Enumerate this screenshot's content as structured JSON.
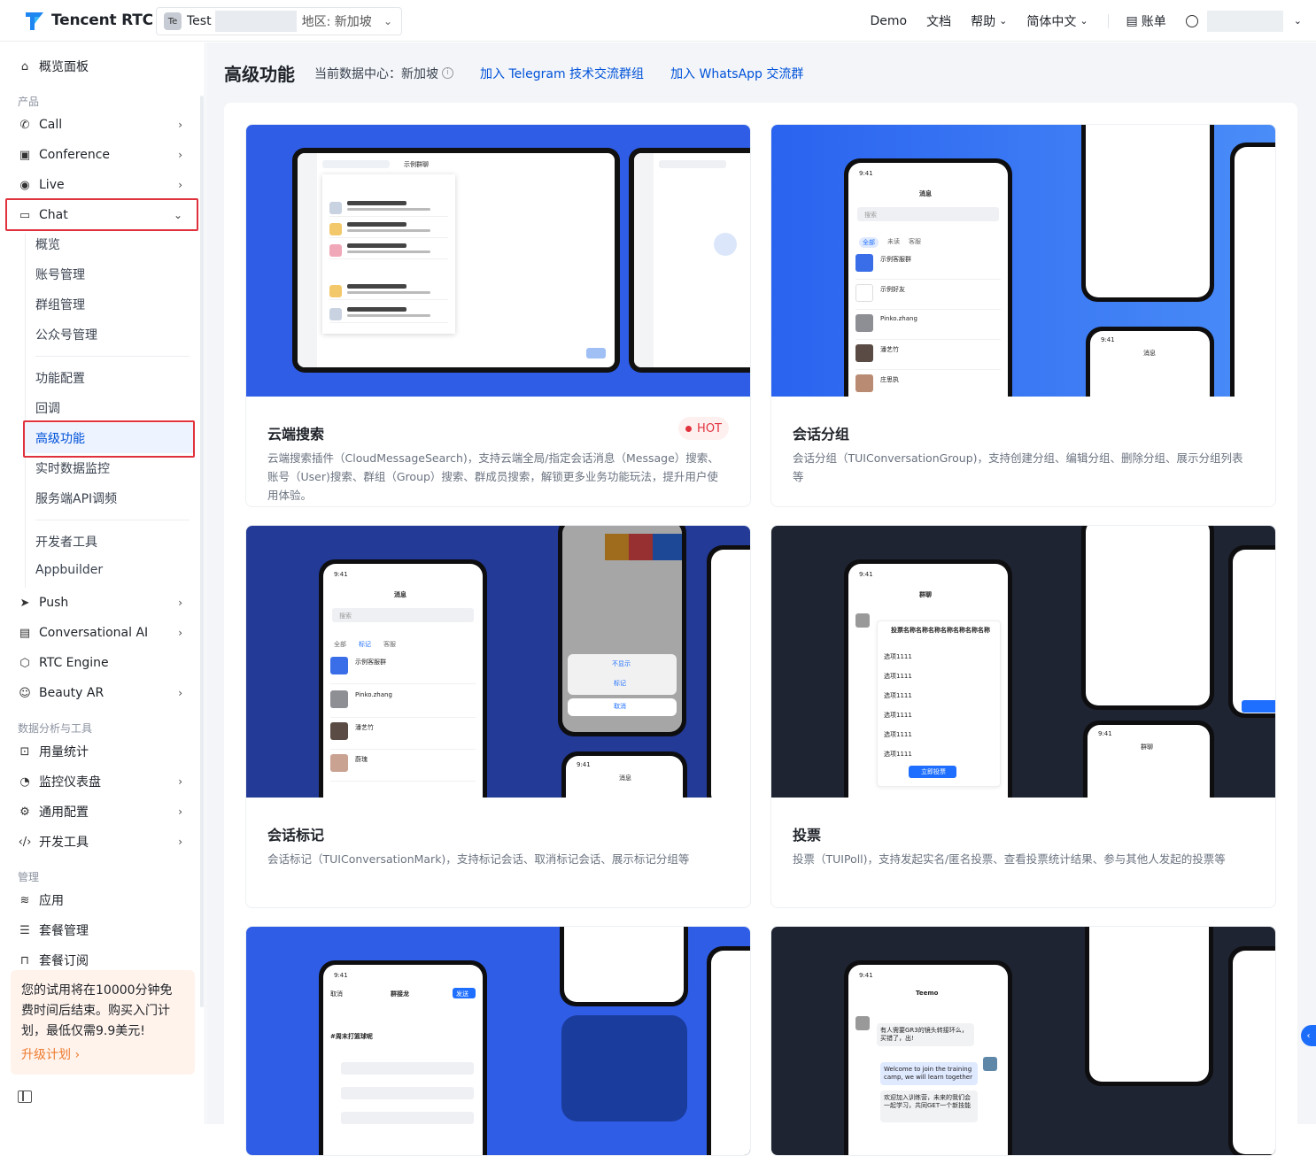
{
  "brand": {
    "name": "Tencent RTC"
  },
  "app_switcher": {
    "badge": "Te",
    "app_name": "Test",
    "region": "地区: 新加坡"
  },
  "topnav": {
    "demo": "Demo",
    "docs": "文档",
    "help": "帮助",
    "lang": "简体中文",
    "billing": "账单"
  },
  "sidebar": {
    "overview": "概览面板",
    "section_product": "产品",
    "products": [
      "Call",
      "Conference",
      "Live",
      "Chat"
    ],
    "chat_sub_group1": [
      "概览",
      "账号管理",
      "群组管理",
      "公众号管理"
    ],
    "chat_sub_group2": [
      "功能配置",
      "回调",
      "高级功能",
      "实时数据监控",
      "服务端API调频"
    ],
    "chat_sub_group3": [
      "开发者工具",
      "Appbuilder"
    ],
    "more_products": [
      "Push",
      "Conversational AI",
      "RTC Engine",
      "Beauty AR"
    ],
    "section_data": "数据分析与工具",
    "data_items": [
      "用量统计",
      "监控仪表盘",
      "通用配置",
      "开发工具"
    ],
    "section_manage": "管理",
    "manage_items": [
      "应用",
      "套餐管理",
      "套餐订阅"
    ],
    "promo_text": "您的试用将在10000分钟免费时间后结束。购买入门计划，最低仅需9.9美元!",
    "promo_link": "升级计划"
  },
  "main": {
    "title": "高级功能",
    "datacenter": "当前数据中心：新加坡",
    "link_telegram": "加入 Telegram 技术交流群组",
    "link_whatsapp": "加入 WhatsApp 交流群"
  },
  "cards": [
    {
      "title": "云端搜索",
      "badge": "HOT",
      "desc": "云端搜索插件（CloudMessageSearch)，支持云端全局/指定会话消息（Message）搜索、账号（User)搜索、群组（Group）搜索、群成员搜索，解锁更多业务功能玩法，提升用户使用体验。"
    },
    {
      "title": "会话分组",
      "desc": "会话分组（TUIConversationGroup)，支持创建分组、编辑分组、删除分组、展示分组列表等"
    },
    {
      "title": "会话标记",
      "desc": "会话标记（TUIConversationMark)，支持标记会话、取消标记会话、展示标记分组等"
    },
    {
      "title": "投票",
      "desc": "投票（TUIPoll)，支持发起实名/匿名投票、查看投票统计结果、参与其他人发起的投票等"
    }
  ],
  "mock": {
    "msg_title": "消息",
    "time": "9:41",
    "search": "搜索",
    "tabs": [
      "全部",
      "未读",
      "客服"
    ],
    "mark_tabs": [
      "全部",
      "标记",
      "客服"
    ],
    "contacts": [
      "示例客服群",
      "示例好友",
      "Pinko.zhang",
      "潘艺竹",
      "庄思执"
    ],
    "mark_contacts": [
      "示例客服群",
      "Pinko.zhang",
      "潘艺竹",
      "蔚瑰"
    ],
    "group_title": "群聊",
    "poll_question": "投票名称名称名称名称名称名称名称",
    "poll_option": "选项1111",
    "poll_submit": "立即投票",
    "sheet_hide": "不显示",
    "sheet_mark": "标记",
    "sheet_cancel": "取消",
    "tablet_chat": "示例群聊",
    "jielong_title": "群接龙",
    "jielong_cancel": "取消",
    "jielong_send": "发送",
    "jielong_topic": "#周末打篮球呢",
    "teemo": "Teemo",
    "msg1": "有人需要GR3的镜头转接环么，买错了，出!",
    "msg2": "Welcome to join the training camp, we will learn together",
    "msg3": "欢迎加入训练营，未来的我们会一起学习，共同GET一个新技能"
  }
}
